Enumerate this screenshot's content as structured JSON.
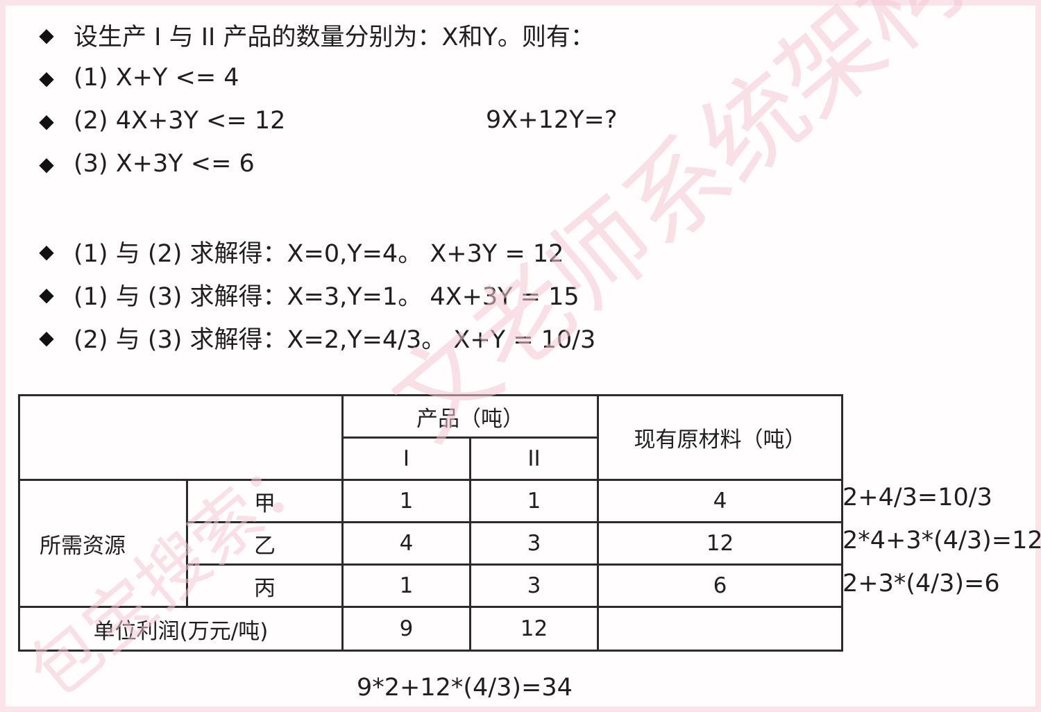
{
  "intro": {
    "text": "设生产 I 与 II 产品的数量分别为：X和Y。则有："
  },
  "constraints": [
    "(1) X+Y <= 4",
    "(2) 4X+3Y <= 12",
    "(3) X+3Y <= 6"
  ],
  "objective": "9X+12Y=?",
  "solutions": [
    "(1) 与 (2) 求解得：X=0,Y=4。 X+3Y = 12",
    "(1) 与 (3) 求解得：X=3,Y=1。 4X+3Y = 15",
    "(2) 与 (3) 求解得：X=2,Y=4/3。 X+Y = 10/3"
  ],
  "table": {
    "product_header": "产品（吨）",
    "product_1": "I",
    "product_2": "II",
    "material_header": "现有原材料（吨）",
    "resource_label": "所需资源",
    "rows": [
      {
        "name": "甲",
        "p1": "1",
        "p2": "1",
        "material": "4"
      },
      {
        "name": "乙",
        "p1": "4",
        "p2": "3",
        "material": "12"
      },
      {
        "name": "丙",
        "p1": "1",
        "p2": "3",
        "material": "6"
      }
    ],
    "profit_label": "单位利润(万元/吨)",
    "profit": {
      "p1": "9",
      "p2": "12",
      "material": ""
    }
  },
  "side_checks": [
    "2+4/3=10/3",
    "2*4+3*(4/3)=12",
    "2+3*(4/3)=6"
  ],
  "final_result": "9*2+12*(4/3)=34",
  "watermark": {
    "text": "文老师系统架构设",
    "text2": "包宝搜索：",
    "color": "#f3c8d3"
  }
}
